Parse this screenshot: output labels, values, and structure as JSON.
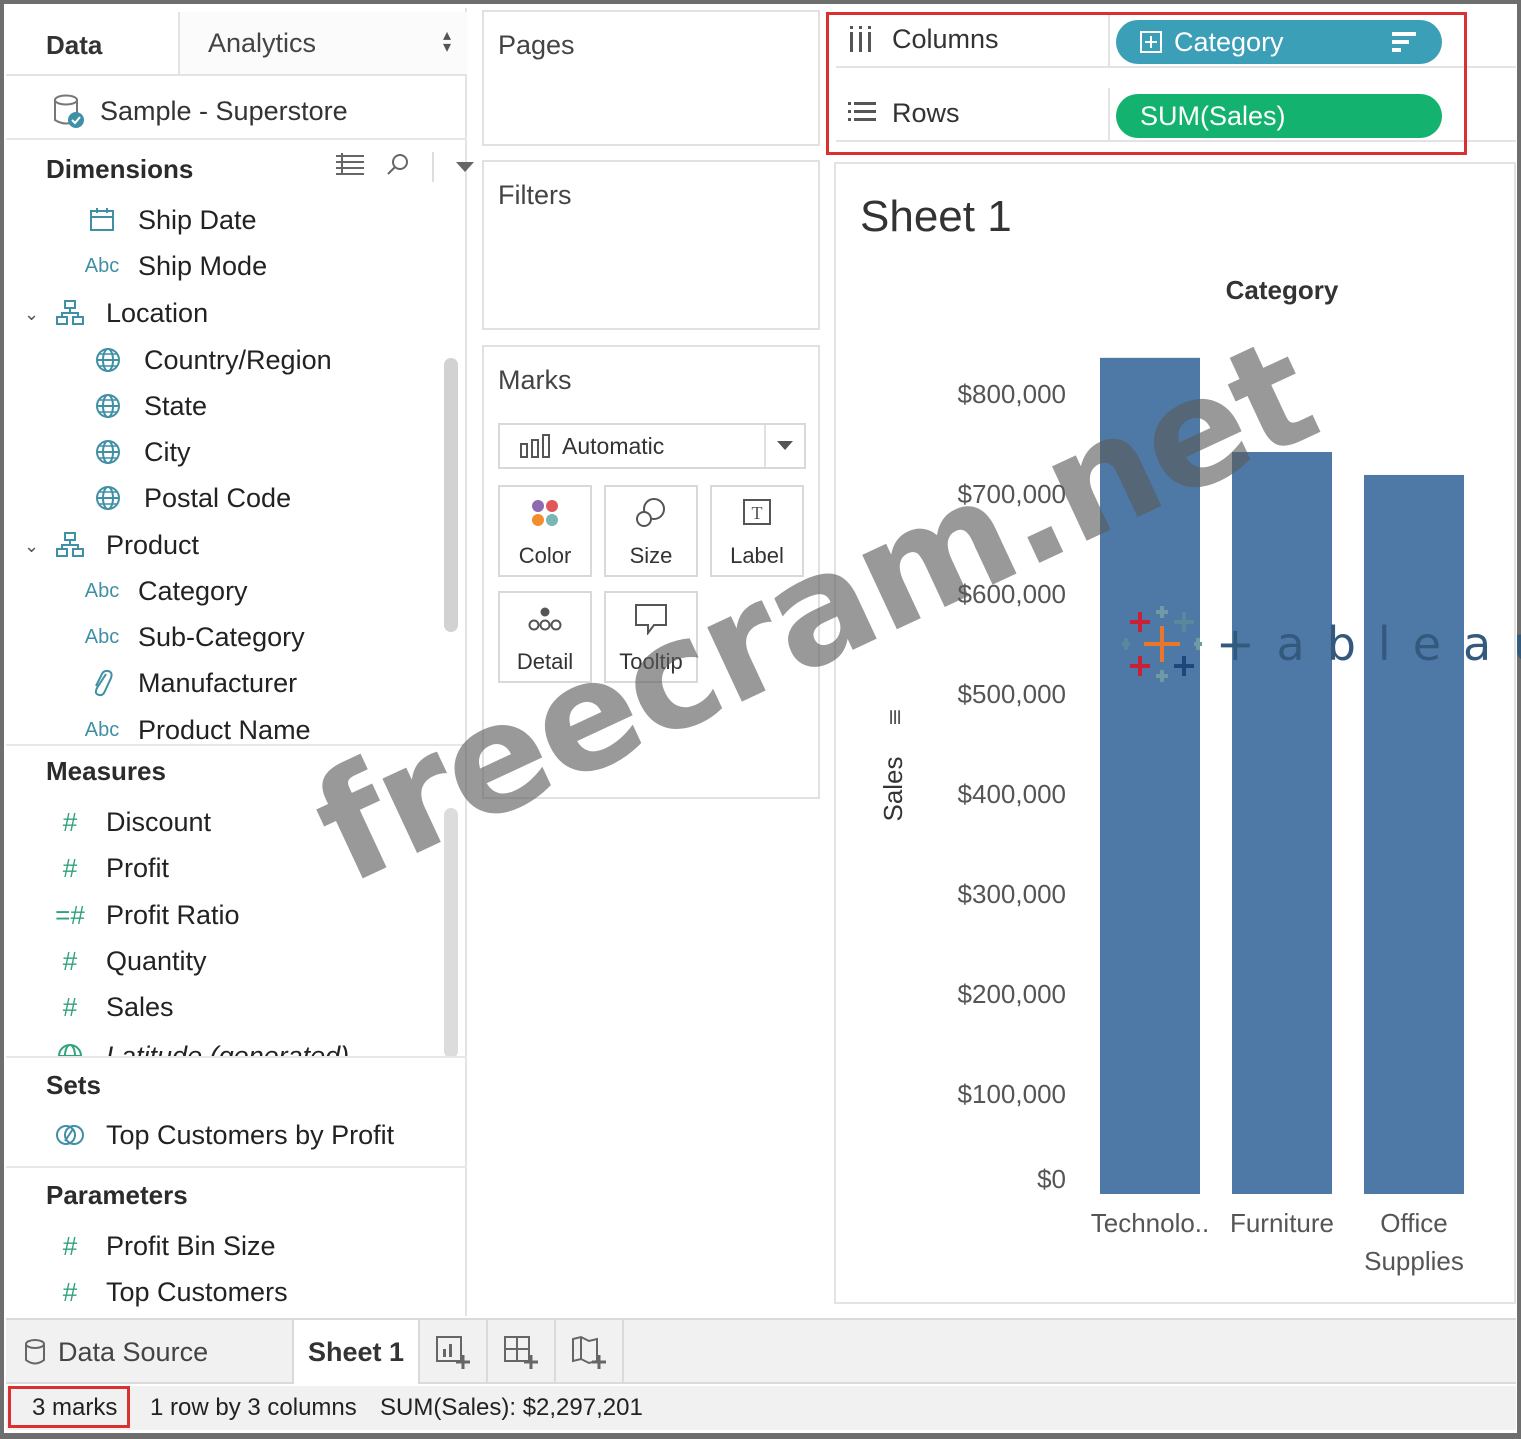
{
  "data_pane": {
    "tab_data": "Data",
    "tab_analytics": "Analytics",
    "datasource": "Sample - Superstore",
    "dimensions_title": "Dimensions",
    "dimensions": [
      {
        "label": "Ship Date",
        "icon": "calendar-icon"
      },
      {
        "label": "Ship Mode",
        "icon": "abc"
      },
      {
        "label": "Location",
        "icon": "hierarchy-icon"
      },
      {
        "label": "Country/Region",
        "icon": "globe-icon"
      },
      {
        "label": "State",
        "icon": "globe-icon"
      },
      {
        "label": "City",
        "icon": "globe-icon"
      },
      {
        "label": "Postal Code",
        "icon": "globe-icon"
      },
      {
        "label": "Product",
        "icon": "hierarchy-icon"
      },
      {
        "label": "Category",
        "icon": "abc"
      },
      {
        "label": "Sub-Category",
        "icon": "abc"
      },
      {
        "label": "Manufacturer",
        "icon": "paperclip-icon"
      },
      {
        "label": "Product Name",
        "icon": "abc"
      }
    ],
    "abc_text": "Abc",
    "measures_title": "Measures",
    "measures": [
      {
        "label": "Discount"
      },
      {
        "label": "Profit"
      },
      {
        "label": "Profit Ratio"
      },
      {
        "label": "Quantity"
      },
      {
        "label": "Sales"
      },
      {
        "label": "Latitude (generated)"
      }
    ],
    "sets_title": "Sets",
    "sets": [
      {
        "label": "Top Customers by Profit"
      }
    ],
    "parameters_title": "Parameters",
    "parameters": [
      {
        "label": "Profit Bin Size"
      },
      {
        "label": "Top Customers"
      }
    ]
  },
  "cards": {
    "pages": "Pages",
    "filters": "Filters",
    "marks": "Marks",
    "mark_type": "Automatic",
    "mark_buttons": [
      "Color",
      "Size",
      "Label",
      "Detail",
      "Tooltip"
    ]
  },
  "shelves": {
    "columns_label": "Columns",
    "columns_pill": "Category",
    "rows_label": "Rows",
    "rows_pill": "SUM(Sales)"
  },
  "view": {
    "sheet_title": "Sheet 1"
  },
  "chart_data": {
    "type": "bar",
    "title": "",
    "header": "Category",
    "xlabel": "",
    "ylabel": "Sales",
    "categories": [
      "Technolo..",
      "Furniture",
      "Office Supplies"
    ],
    "values": [
      836154,
      741999,
      719047
    ],
    "ylim": [
      0,
      850000
    ],
    "yticks": [
      0,
      100000,
      200000,
      300000,
      400000,
      500000,
      600000,
      700000,
      800000
    ],
    "ytick_labels": [
      "$0",
      "$100,000",
      "$200,000",
      "$300,000",
      "$400,000",
      "$500,000",
      "$600,000",
      "$700,000",
      "$800,000"
    ],
    "bar_color": "#4e79a7",
    "grid": false
  },
  "tabs": {
    "data_source": "Data Source",
    "sheet": "Sheet 1"
  },
  "status": {
    "marks": "3 marks",
    "dims": "1 row by 3 columns",
    "sum": "SUM(Sales): $2,297,201"
  },
  "overlays": {
    "watermark": "freecram.net",
    "logo": "+ableau"
  },
  "colors": {
    "dimension_pill": "#3c9fb8",
    "measure_pill": "#13b36f",
    "highlight": "#d93030"
  }
}
